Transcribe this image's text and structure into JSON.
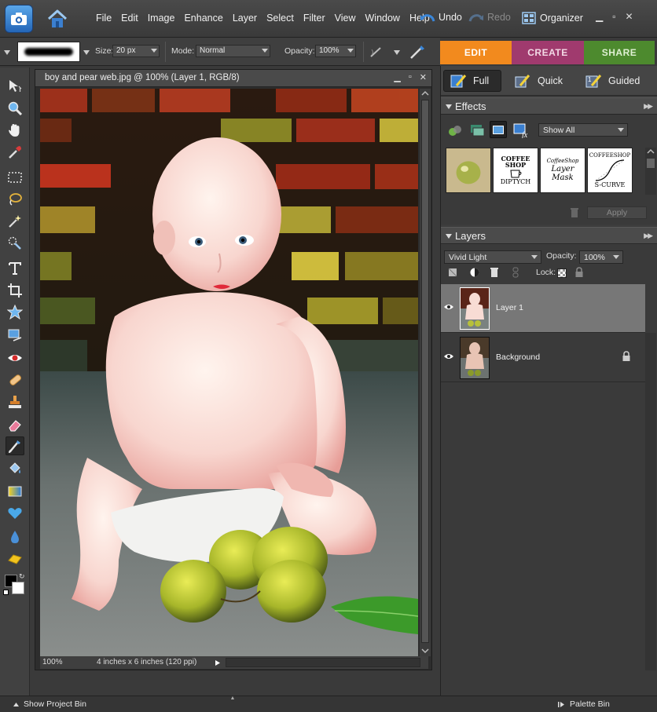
{
  "menubar": {
    "items": [
      "File",
      "Edit",
      "Image",
      "Enhance",
      "Layer",
      "Select",
      "Filter",
      "View",
      "Window",
      "Help"
    ],
    "undo": "Undo",
    "redo": "Redo",
    "organizer": "Organizer"
  },
  "options": {
    "size_label": "Size:",
    "size_value": "20 px",
    "mode_label": "Mode:",
    "mode_value": "Normal",
    "opacity_label": "Opacity:",
    "opacity_value": "100%"
  },
  "mode_tabs": {
    "edit": "EDIT",
    "create": "CREATE",
    "share": "SHARE"
  },
  "document": {
    "title": "boy and pear web.jpg @ 100% (Layer 1, RGB/8)",
    "zoom": "100%",
    "doc_info": "4 inches x 6 inches (120 ppi)"
  },
  "view_modes": {
    "full": "Full",
    "quick": "Quick",
    "guided": "Guided"
  },
  "effects": {
    "title": "Effects",
    "filter_value": "Show All",
    "apply": "Apply",
    "thumbs": [
      {
        "line1": "COFFEE",
        "line2": "SHOP",
        "line3": "DIPTYCH"
      },
      {
        "line1": "CoffeeShop",
        "line2": "Layer",
        "line3": "Mask"
      },
      {
        "line1": "COFFEESHOP",
        "line2": "",
        "line3": "S-CURVE"
      }
    ]
  },
  "layers": {
    "title": "Layers",
    "blend_mode": "Vivid Light",
    "opacity_label": "Opacity:",
    "opacity_value": "100%",
    "lock_label": "Lock:",
    "rows": [
      {
        "name": "Layer 1"
      },
      {
        "name": "Background"
      }
    ]
  },
  "bottom": {
    "project_bin": "Show Project Bin",
    "palette_bin": "Palette Bin"
  },
  "colors": {
    "edit_tab": "#f28a1e",
    "create_tab": "#a03a6e",
    "share_tab": "#4d8a2e",
    "undo_icon": "#3a86d8"
  }
}
